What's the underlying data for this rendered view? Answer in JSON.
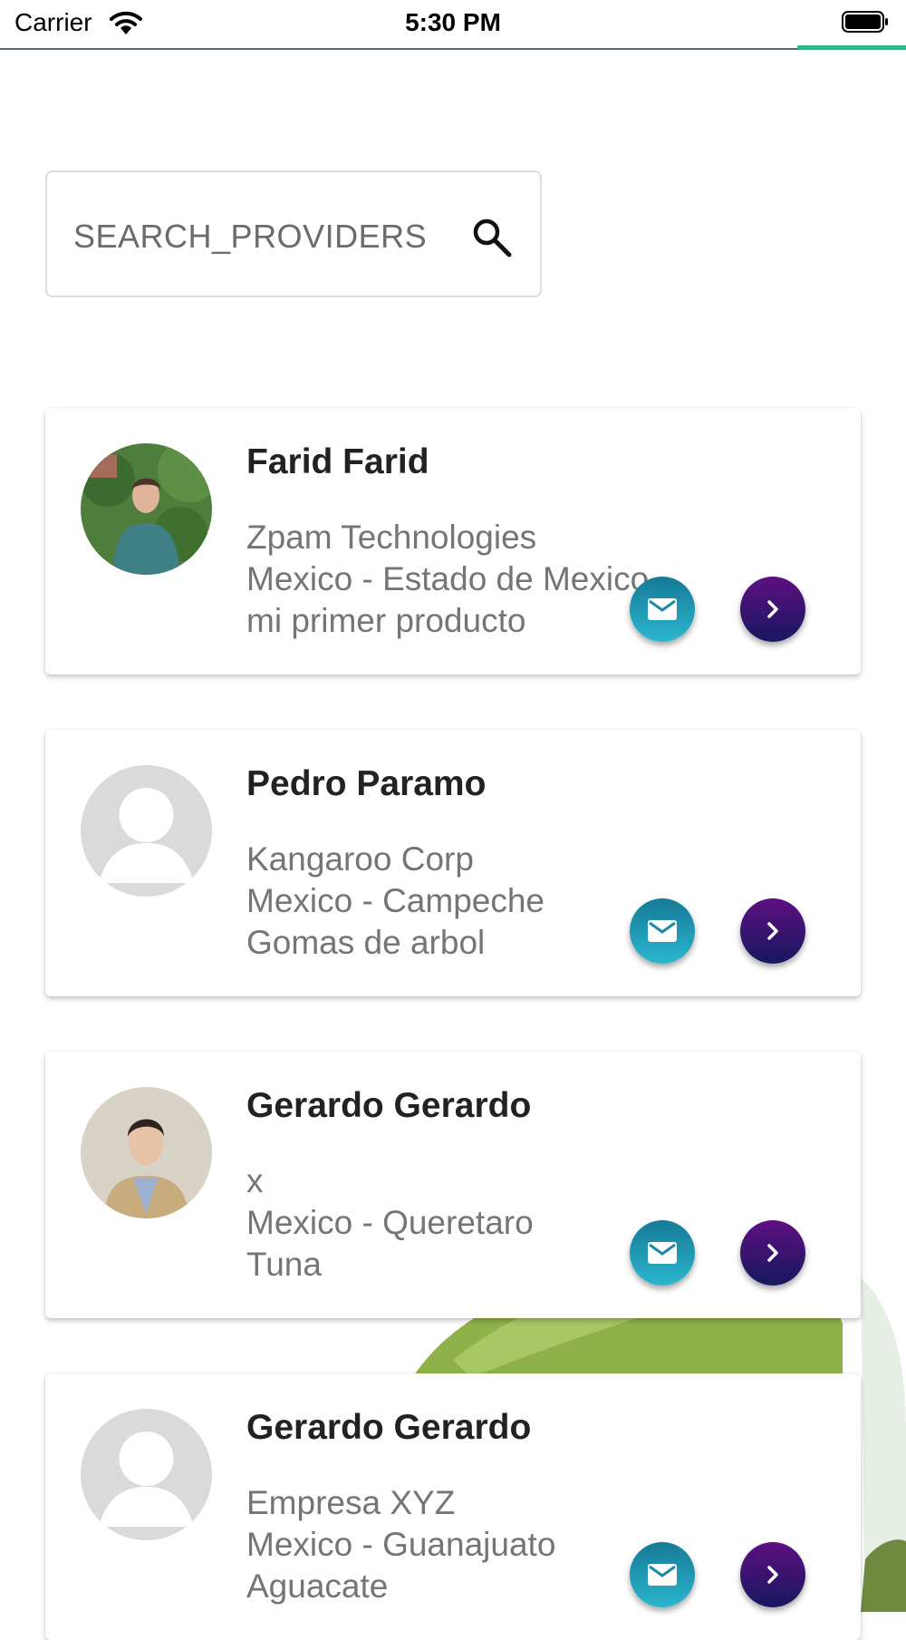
{
  "status_bar": {
    "carrier": "Carrier",
    "time": "5:30 PM",
    "wifi_icon": "wifi-icon",
    "battery_icon": "battery-icon"
  },
  "search": {
    "placeholder": "SEARCH_PROVIDERS",
    "icon": "search-icon"
  },
  "colors": {
    "mail_button_gradient": [
      "#167a96",
      "#2bb6cf"
    ],
    "next_button_gradient": [
      "#5e0f82",
      "#17185f"
    ],
    "status_accent": "#2fb58c",
    "name_text": "#222222",
    "detail_text": "#757575"
  },
  "providers": [
    {
      "name": "Farid Farid",
      "company": "Zpam Technologies",
      "location": "Mexico - Estado de Mexico",
      "product": "mi primer producto",
      "avatar": "photo",
      "mail_icon": "mail-icon",
      "next_icon": "chevron-right-icon"
    },
    {
      "name": "Pedro Paramo",
      "company": "Kangaroo Corp",
      "location": "Mexico - Campeche",
      "product": "Gomas de arbol",
      "avatar": "placeholder",
      "mail_icon": "mail-icon",
      "next_icon": "chevron-right-icon"
    },
    {
      "name": "Gerardo Gerardo",
      "company": "x",
      "location": "Mexico - Queretaro",
      "product": "Tuna",
      "avatar": "photo",
      "mail_icon": "mail-icon",
      "next_icon": "chevron-right-icon"
    },
    {
      "name": "Gerardo Gerardo",
      "company": "Empresa XYZ",
      "location": "Mexico - Guanajuato",
      "product": "Aguacate",
      "avatar": "placeholder",
      "mail_icon": "mail-icon",
      "next_icon": "chevron-right-icon"
    }
  ]
}
